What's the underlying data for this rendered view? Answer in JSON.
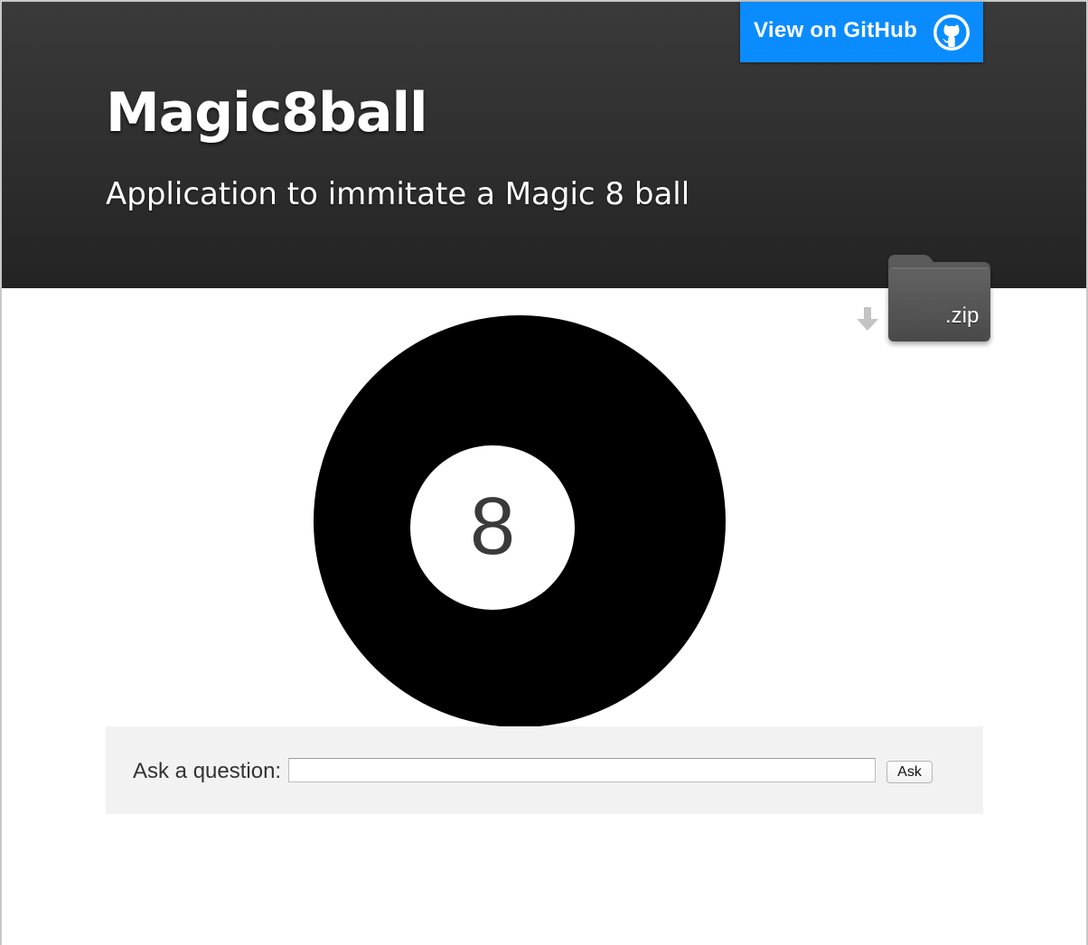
{
  "header": {
    "title": "Magic8ball",
    "subtitle": "Application to immitate a Magic 8 ball",
    "github_button": {
      "label": "View on GitHub",
      "icon": "github-octocat-icon"
    },
    "download": {
      "label": ".zip",
      "icons": [
        "download-arrow-icon",
        "folder-icon"
      ]
    }
  },
  "ball": {
    "number": "8"
  },
  "question_form": {
    "label": "Ask a question:",
    "input_value": "",
    "button_label": "Ask"
  },
  "colors": {
    "header_background": "#2d2d2d",
    "github_button": "#0a8cff",
    "ball": "#000000",
    "panel_background": "#f2f2f2"
  }
}
